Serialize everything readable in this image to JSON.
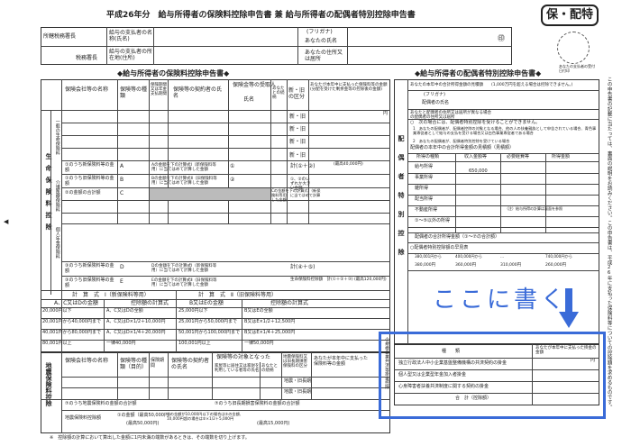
{
  "header": {
    "title": "平成26年分　給与所得者の保険料控除申告書 兼 給与所得者の配偶者特別控除申告書",
    "badge": "保・配特",
    "stamp_ring": "あなたの支払者の受付日付印"
  },
  "top_fields": {
    "office_head": "所轄税務署長",
    "payer_name": "給与の支払者の名称(氏名)",
    "payer_address": "給与の支払者の所在地(住所)",
    "tax_office": "税務署長",
    "furigana": "(フリガナ)",
    "your_name": "あなたの氏名",
    "your_address": "あなたの住所又は居所",
    "seal": "㊞"
  },
  "insurance": {
    "section_title": "◆給与所得者の保険料控除申告書◆",
    "col_company": "保険会社等の名称",
    "col_type": "保険等の種類",
    "col_period": "保険期間又は年金支払期間",
    "col_contractor": "保険等の契約者の氏名",
    "col_receiver": "保険金等の受取人",
    "col_receiver_name": "氏名",
    "col_receiver_rel": "あなたとの続柄",
    "col_newold": "新・旧の区分",
    "col_amount": "あなたが本年中に支払った保険料等の金額(分配を受けた剰余金等の控除後の金額)",
    "row_life": "一般の生命保険料",
    "row_medical": "介護医療保険料",
    "row_pension": "個人年金保険料",
    "side_label": "生命保険料控除",
    "new_old": "新・旧",
    "yen": "円",
    "sumA": "①のうち新保険料等の金額",
    "sumB": "①のうち旧保険料等の金額",
    "sumC": "②の金額の合計額",
    "sumD": "③のうち新保険料等の金額",
    "sumE": "③のうち旧保険料等の金額",
    "cellA": "A",
    "cellB": "B",
    "cellC": "C",
    "cellD": "D",
    "cellE": "E",
    "calc_a": "Aの金額を下の計算式Ⅰ（新保険料等用）に当てはめて計算した金額",
    "calc_b": "Bの金額を下の計算式Ⅱ（旧保険料等用）に当てはめて計算した金額",
    "calc_c": "Cの金額を下の計算式Ⅰ（新保険料等用）に当てはめて計算した金額",
    "calc_d": "Dの金額を下の計算式Ⅰ（新保険料等用）に当てはめて計算した金額",
    "calc_e": "Eの金額を下の計算式Ⅱ（旧保険料等用）に当てはめて計算した金額",
    "max40k": "(最高40,000円)",
    "max50k": "(最高50,000円)",
    "total_1": "計(①＋②)",
    "large_of": "①、②のいずれか大きい金額",
    "total_4": "計(④＋⑤)",
    "total_limit": "生命保険料控除額　計(①＋②＋③) (最高120,000円)",
    "formula1_title": "計　算　式　Ⅰ（新保険料等用）",
    "formula2_title": "計　算　式　Ⅱ（旧保険料等用）",
    "formula_head1": "A、C又はDの金額",
    "formula_head2": "控除額の計算式",
    "formula_head3": "B又はEの金額",
    "f1_rows": [
      "20,000円以下",
      "20,001円から40,000円まで",
      "40,001円から80,000円まで",
      "80,001円以上"
    ],
    "f1_calc": [
      "A、C又はDの全額",
      "A、C又はD×1/2＋10,000円",
      "A、C又はD×1/4＋20,000円",
      "一律40,000円"
    ],
    "f2_rows": [
      "25,000円以下",
      "25,001円から50,000円まで",
      "50,001円から100,000円まで",
      "100,001円以上"
    ],
    "f2_calc": [
      "B又はEの全額",
      "B又はE×1/2＋12,500円",
      "B又はE×1/4＋25,000円",
      "一律50,000円"
    ]
  },
  "earthquake": {
    "side_label": "地震保険料控除",
    "col_company": "保険会社等の名称",
    "col_type": "保険等の種類（目的）",
    "col_period": "保険期間",
    "col_contractor": "保険等の契約者の氏名",
    "col_target": "保険等の対象となった",
    "col_target2": "家屋等に居住又は家財を利用している者等の氏名",
    "col_rel": "あなたとの続柄",
    "col_kind": "地震保険料又は旧長期損害保険料の区分",
    "col_paid": "あなたが本年中に支払った保険料等の金額",
    "kind_label": "地震・旧長期",
    "sum_quake": "⑦のうち地震保険料の金額の合計額",
    "sum_long": "⑦のうち旧長期損害保険料の金額の合計額",
    "deduction": "地震保険料控除額",
    "ded_detail": "①の金額（最高50,000円）",
    "ded_detail2": "②の金額が10,000円以下の場合は②の金額、10,000円超の場合は⑤×1/2＋5,000円",
    "max50k": "(最高50,000円)",
    "max15k": "(最高15,000円)",
    "footnote": "※　控除額の計算において算出した金額に1円未満の端数があるときは、その端数を切り上げます。"
  },
  "spouse": {
    "section_title": "◆給与所得者の配偶者特別控除申告書◆",
    "side_label": "配偶者特別控除",
    "income_note": "あなたの本年中の合計所得金額の見積額",
    "income_limit": "(1,000万円を超える場合は控除できません。)",
    "furigana": "(フリガナ)",
    "spouse_name": "配偶者の氏名",
    "address_note": "あなたと配偶者の住所又は居所が異なる場合の配偶者の住所又は居所",
    "cond_title": "○　次の場合には、配偶者特別控除を受けることができません。",
    "cond1": "1　あなたの配偶者が、配偶者控除の対象となる場合、他の人の扶養親族として申告されている場合、青色事業専従者として給与の支払を受ける場合又は白色事業専従者である場合",
    "cond2": "2　あなたの配偶者が、配偶者特別控除を受けている場合",
    "income_title": "配偶者の本年中の合計所得金額の見積額（見積額）",
    "table_headers": [
      "所得の種類",
      "収入金額等",
      "必要経費等",
      "所得金額"
    ],
    "income_rows": [
      "給与所得",
      "事業所得",
      "雑所得",
      "配当所得",
      "不動産所得",
      "①～⑤以外の所得"
    ],
    "sample_income": "650,000",
    "sample_note": "（注）給与所得の計算は裏面を参照",
    "total_income": "配偶者の合計所得金額（①～⑦の合計額）",
    "deduction_title": "○配偶者特別控除額の早見表",
    "ded_headers": [
      "380,001円から",
      "400,000円から",
      "...",
      "740,000円から"
    ],
    "ded_values": [
      "380,000円",
      "360,000円",
      "310,000円",
      "260,000円"
    ]
  },
  "small_business": {
    "side_label": "小規模企業共済等掛金控除",
    "col_type": "種　　類",
    "col_amount": "あなたが本年中に支払った掛金の金額",
    "row1": "独立行政法人中小企業基盤整備機構の共済契約の掛金",
    "row2": "個人型又は企業型年金加入者掛金",
    "row3": "心身障害者扶養共済制度に関する契約の掛金",
    "total": "合　計（控除額）",
    "yen": "円"
  },
  "annotation": {
    "callout": "ここに書く",
    "accent": "#3a6bd8"
  },
  "right_note": "この申告書の記載に当たっては、裏面の説明をお読みください。この申告書は、平成26年に支払った保険料等についての控除額を求めるものです。",
  "page_marker": "◀"
}
